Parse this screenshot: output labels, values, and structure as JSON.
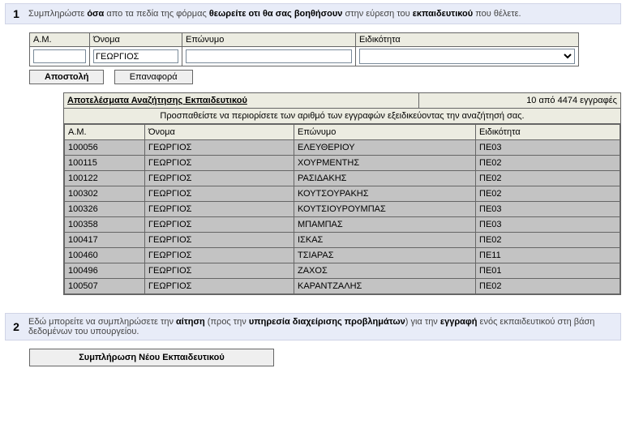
{
  "step1": {
    "num": "1",
    "text_pre": "Συμπληρώστε ",
    "text_b1": "όσα",
    "text_mid1": " απο τα πεδία της φόρμας ",
    "text_b2": "θεωρείτε οτι θα σας βοηθήσουν",
    "text_mid2": " στην εύρεση του ",
    "text_b3": "εκπαιδευτικού",
    "text_end": " που θέλετε."
  },
  "headers": {
    "am": "A.M.",
    "name": "Όνομα",
    "surname": "Επώνυμο",
    "specialty": "Ειδικότητα"
  },
  "inputs": {
    "am": "",
    "name": "ΓΕΩΡΓΙΟΣ",
    "surname": "",
    "specialty": ""
  },
  "buttons": {
    "submit": "Αποστολή",
    "reset": "Επαναφορά"
  },
  "results": {
    "title": "Αποτελέσματα Αναζήτησης Εκπαιδευτικού",
    "count": "10 από 4474 εγγραφές",
    "hint": "Προσπαθείστε να περιορίσετε των αριθμό των εγγραφών εξειδικεύοντας την αναζήτησή σας.",
    "rows": [
      {
        "am": "100056",
        "name": "ΓΕΩΡΓΙΟΣ",
        "surname": "ΕΛΕΥΘΕΡΙΟΥ",
        "spec": "ΠΕ03"
      },
      {
        "am": "100115",
        "name": "ΓΕΩΡΓΙΟΣ",
        "surname": "ΧΟΥΡΜΕΝΤΗΣ",
        "spec": "ΠΕ02"
      },
      {
        "am": "100122",
        "name": "ΓΕΩΡΓΙΟΣ",
        "surname": "ΡΑΣΙΔΑΚΗΣ",
        "spec": "ΠΕ02"
      },
      {
        "am": "100302",
        "name": "ΓΕΩΡΓΙΟΣ",
        "surname": "ΚΟΥΤΣΟΥΡΑΚΗΣ",
        "spec": "ΠΕ02"
      },
      {
        "am": "100326",
        "name": "ΓΕΩΡΓΙΟΣ",
        "surname": "ΚΟΥΤΣΙΟΥΡΟΥΜΠΑΣ",
        "spec": "ΠΕ03"
      },
      {
        "am": "100358",
        "name": "ΓΕΩΡΓΙΟΣ",
        "surname": "ΜΠΑΜΠΑΣ",
        "spec": "ΠΕ03"
      },
      {
        "am": "100417",
        "name": "ΓΕΩΡΓΙΟΣ",
        "surname": "ΙΣΚΑΣ",
        "spec": "ΠΕ02"
      },
      {
        "am": "100460",
        "name": "ΓΕΩΡΓΙΟΣ",
        "surname": "ΤΣΙΑΡΑΣ",
        "spec": "ΠΕ11"
      },
      {
        "am": "100496",
        "name": "ΓΕΩΡΓΙΟΣ",
        "surname": "ΖΑΧΟΣ",
        "spec": "ΠΕ01"
      },
      {
        "am": "100507",
        "name": "ΓΕΩΡΓΙΟΣ",
        "surname": "ΚΑΡΑΝΤΖΑΛΗΣ",
        "spec": "ΠΕ02"
      }
    ]
  },
  "step2": {
    "num": "2",
    "text_pre": "Εδώ μπορείτε να συμπληρώσετε την ",
    "text_b1": "αίτηση",
    "text_mid1": " (προς την ",
    "text_b2": "υπηρεσία διαχείρισης προβλημάτων",
    "text_mid2": ") για την ",
    "text_b3": "εγγραφή",
    "text_end": " ενός εκπαιδευτικού στη βάση δεδομένων του υπουργείου."
  },
  "newTeacherBtn": "Συμπλήρωση Νέου Εκπαιδευτικού"
}
